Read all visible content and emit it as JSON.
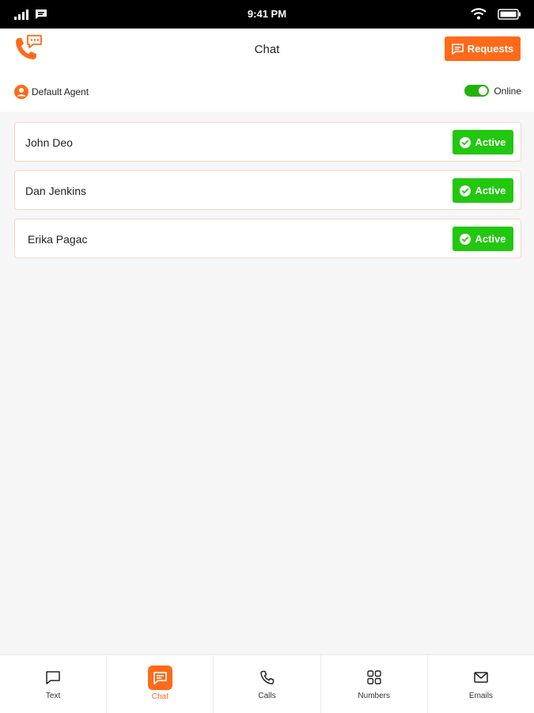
{
  "status_bar": {
    "time": "9:41 PM"
  },
  "header": {
    "title": "Chat",
    "requests_label": "Requests"
  },
  "agent": {
    "name": "Default Agent",
    "status_label": "Online",
    "online": true
  },
  "chats": [
    {
      "name": "John Deo",
      "status": "Active"
    },
    {
      "name": "Dan Jenkins",
      "status": "Active"
    },
    {
      "name": "Erika Pagac",
      "status": "Active"
    }
  ],
  "nav": [
    {
      "label": "Text",
      "icon": "message-square-icon"
    },
    {
      "label": "Chat",
      "icon": "chat-bubble-icon",
      "active": true
    },
    {
      "label": "Calls",
      "icon": "phone-icon"
    },
    {
      "label": "Numbers",
      "icon": "grid-icon"
    },
    {
      "label": "Emails",
      "icon": "mail-icon"
    }
  ],
  "colors": {
    "accent": "#ff6a1a",
    "active": "#22c70f",
    "toggle_on": "#22b20a"
  }
}
